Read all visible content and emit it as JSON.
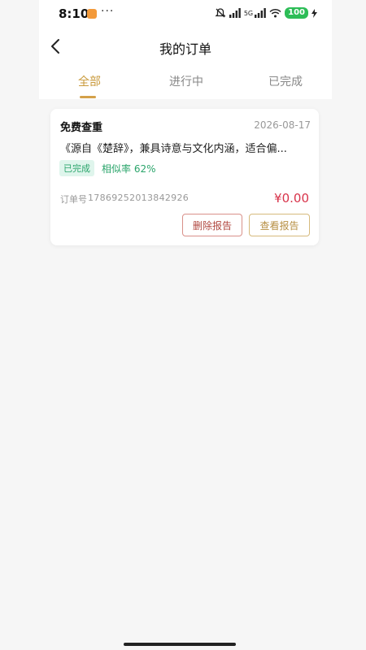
{
  "status_bar": {
    "time": "8:10",
    "dots": "···",
    "network": "5G",
    "battery": "100"
  },
  "nav": {
    "title": "我的订单"
  },
  "tabs": [
    {
      "label": "全部",
      "active": true
    },
    {
      "label": "进行中",
      "active": false
    },
    {
      "label": "已完成",
      "active": false
    }
  ],
  "orders": [
    {
      "type": "免费查重",
      "date": "2026-08-17",
      "description": "《源自《楚辞》，兼具诗意与文化内涵，适合偏...",
      "status": "已完成",
      "similarity_label": "相似率 62%",
      "order_no_label": "订单号",
      "order_no": "17869252013842926",
      "price": "¥0.00",
      "delete_label": "删除报告",
      "view_label": "查看报告"
    }
  ],
  "colors": {
    "accent_gold": "#c99a3c",
    "price_red": "#d8334a",
    "success_green": "#2ba56b",
    "battery_green": "#2dbd57"
  },
  "icons": {
    "back": "chevron-left-icon",
    "mute": "bell-muted-icon",
    "signal": "signal-bars-icon",
    "wifi": "wifi-icon",
    "charge": "lightning-icon"
  }
}
